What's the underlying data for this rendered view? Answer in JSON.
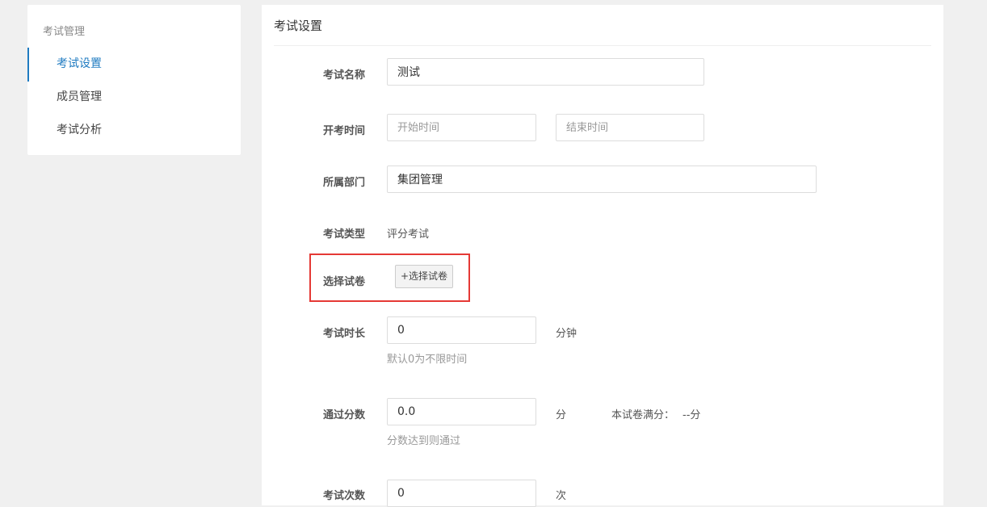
{
  "sidebar": {
    "title": "考试管理",
    "items": [
      {
        "label": "考试设置",
        "active": true
      },
      {
        "label": "成员管理",
        "active": false
      },
      {
        "label": "考试分析",
        "active": false
      }
    ]
  },
  "main": {
    "title": "考试设置",
    "form": {
      "name": {
        "label": "考试名称",
        "value": "测试"
      },
      "time": {
        "label": "开考时间",
        "start_placeholder": "开始时间",
        "end_placeholder": "结束时间"
      },
      "dept": {
        "label": "所属部门",
        "value": "集团管理"
      },
      "type": {
        "label": "考试类型",
        "value": "评分考试"
      },
      "paper": {
        "label": "选择试卷",
        "button_label": "+选择试卷"
      },
      "duration": {
        "label": "考试时长",
        "value": "0",
        "unit": "分钟",
        "hint": "默认0为不限时间"
      },
      "pass_score": {
        "label": "通过分数",
        "value": "0.0",
        "unit": "分",
        "full_score_label": "本试卷满分：",
        "full_score_value": "--分",
        "hint": "分数达到则通过"
      },
      "attempts": {
        "label": "考试次数",
        "value": "0",
        "unit": "次"
      }
    }
  },
  "colors": {
    "accent": "#1f7bc1",
    "highlight": "#e53935"
  }
}
